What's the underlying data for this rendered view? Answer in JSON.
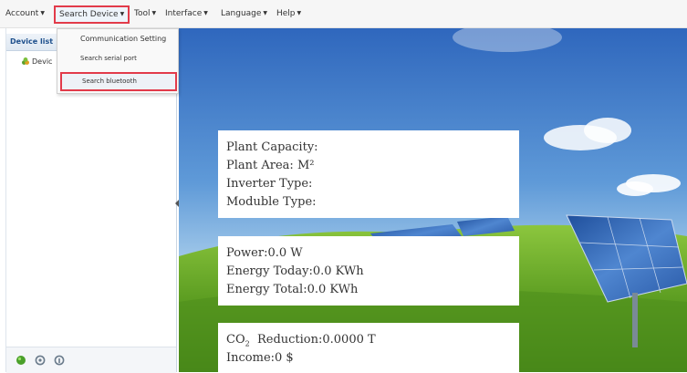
{
  "menu": {
    "account": "Account",
    "search_device": "Search Device",
    "tool": "Tool",
    "interface": "Interface",
    "language": "Language",
    "help": "Help"
  },
  "dropdown": {
    "communication_setting": "Communication Setting",
    "search_serial_port": "Search serial port",
    "search_bluetooth": "Search bluetooth"
  },
  "left_panel": {
    "title": "Device list",
    "tree_item": "Devic"
  },
  "plant_card": {
    "capacity": "Plant Capacity:",
    "area": "Plant Area: M²",
    "inverter_type": "Inverter Type:",
    "module_type": "Moduble Type:"
  },
  "energy_card": {
    "power": "Power:0.0 W",
    "energy_today": "Energy Today:0.0 KWh",
    "energy_total": "Energy Total:0.0 KWh"
  },
  "eco_card": {
    "co2_label": "CO",
    "co2_sub": "2",
    "co2_value": "Reduction:0.0000 T",
    "income": "Income:0 $"
  },
  "colors": {
    "highlight_border": "#e23b4a",
    "sky_top": "#3a72c6",
    "grass": "#6fae2a"
  },
  "icons": {
    "tree_icon": "plant-icon",
    "bottom_icons": [
      "status-green-icon",
      "settings-icon",
      "info-icon"
    ]
  }
}
